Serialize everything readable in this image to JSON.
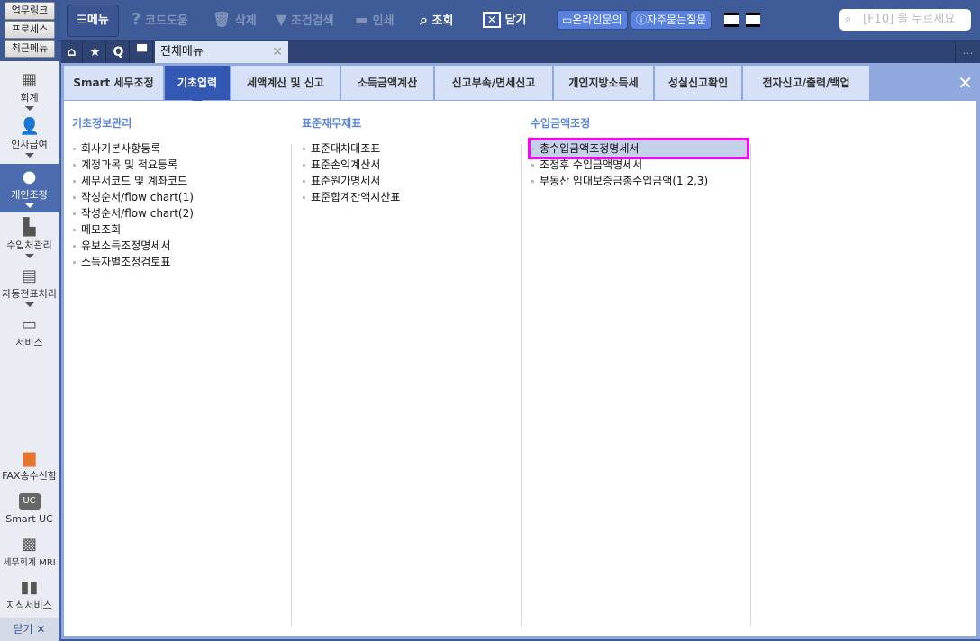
{
  "quick_buttons": [
    "업무링크",
    "프로세스",
    "최근메뉴"
  ],
  "sidebar": {
    "items": [
      {
        "label": "회계",
        "icon": "calculator-icon"
      },
      {
        "label": "인사급여",
        "icon": "person-coins-icon"
      },
      {
        "label": "개인조정",
        "icon": "person-icon",
        "active": true
      },
      {
        "label": "수입처관리",
        "icon": "person-building-icon"
      },
      {
        "label": "자동전표처리",
        "icon": "document-database-icon"
      },
      {
        "label": "서비스",
        "icon": "monitor-icon"
      }
    ],
    "bottom": [
      {
        "label": "FAX송수신함",
        "icon": "fax-icon"
      },
      {
        "label": "Smart UC",
        "icon": "uc-chat-icon",
        "badge": "UC"
      },
      {
        "label": "세무회계 MRI",
        "icon": "mri-chart-icon"
      },
      {
        "label": "지식서비스",
        "icon": "book-icon"
      }
    ],
    "close_label": "닫기"
  },
  "toolbar": {
    "menu": "메뉴",
    "code_help": "코드도움",
    "delete": "삭제",
    "filter": "조건검색",
    "print": "인쇄",
    "search": "조회",
    "close": "닫기",
    "online_inquiry": "온라인문의",
    "faq": "자주묻는질문",
    "search_placeholder": "[F10] 을 누르세요"
  },
  "doc_tabs": {
    "active": "전체메뉴"
  },
  "menu_tabs": [
    "Smart 세무조정",
    "기초입력",
    "세액계산 및 신고",
    "소득금액계산",
    "신고부속/면세신고",
    "개인지방소득세",
    "성실신고확인",
    "전자신고/출력/백업"
  ],
  "columns": [
    {
      "title": "기초정보관리",
      "items": [
        "회사기본사항등록",
        "계정과목 및 적요등록",
        "세무서코드 및 계좌코드",
        "작성순서/flow chart(1)",
        "작성순서/flow chart(2)",
        "메모조회",
        "유보소득조정명세서",
        "소득자별조정검토표"
      ]
    },
    {
      "title": "표준재무제표",
      "items": [
        "표준대차대조표",
        "표준손익계산서",
        "표준원가명세서",
        "표준합계잔액시산표"
      ]
    },
    {
      "title": "수입금액조정",
      "items": [
        "총수입금액조정명세서",
        "조정후 수입금액명세서",
        "부동산 임대보증금총수입금액(1,2,3)"
      ]
    }
  ]
}
